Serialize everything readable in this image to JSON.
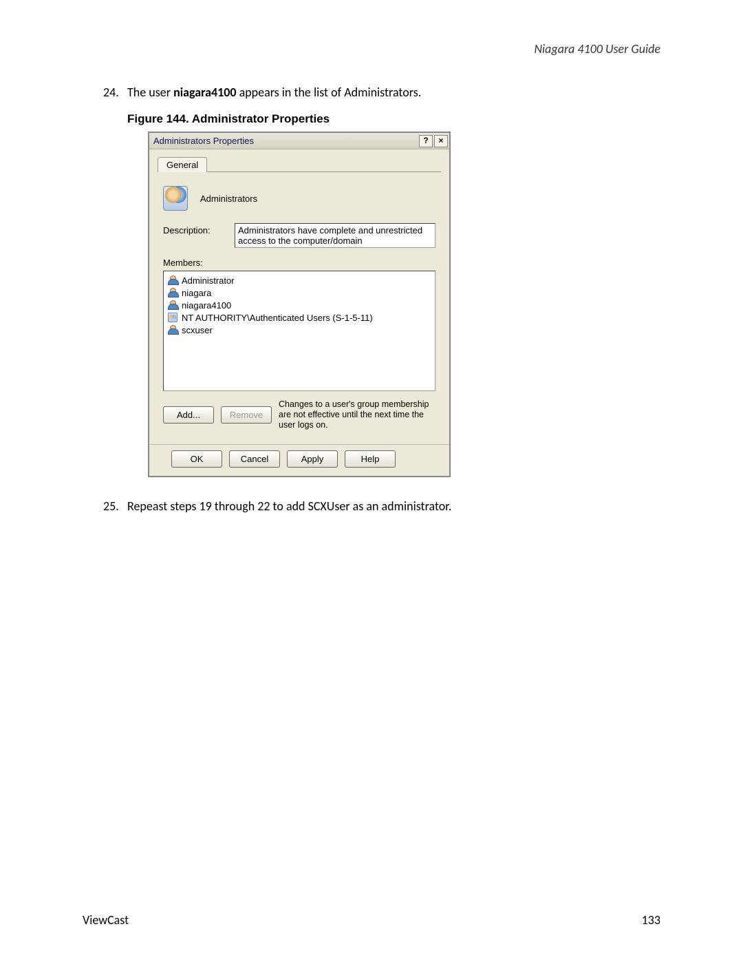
{
  "header": {
    "guide_title": "Niagara 4100 User Guide"
  },
  "steps": {
    "s24": {
      "num": "24.",
      "prefix": "The user ",
      "bold": "niagara4100",
      "suffix": " appears in the list of Administrators."
    },
    "s25": {
      "num": "25.",
      "text": "Repeast steps 19 through 22 to add SCXUser as an administrator."
    }
  },
  "figure": {
    "caption": "Figure 144. Administrator Properties"
  },
  "dialog": {
    "title": "Administrators Properties",
    "help_btn": "?",
    "close_btn": "×",
    "tab_general": "General",
    "group_name": "Administrators",
    "description_label": "Description:",
    "description_value": "Administrators have complete and unrestricted access to the computer/domain",
    "members_label": "Members:",
    "members": [
      {
        "icon": "user",
        "name": "Administrator"
      },
      {
        "icon": "user",
        "name": "niagara"
      },
      {
        "icon": "user",
        "name": "niagara4100"
      },
      {
        "icon": "group",
        "name": "NT AUTHORITY\\Authenticated Users (S-1-5-11)"
      },
      {
        "icon": "user",
        "name": "scxuser"
      }
    ],
    "add_btn": "Add...",
    "remove_btn": "Remove",
    "change_note": "Changes to a user's group membership are not effective until the next time the user logs on.",
    "ok_btn": "OK",
    "cancel_btn": "Cancel",
    "apply_btn": "Apply",
    "help_footer_btn": "Help"
  },
  "footer": {
    "left": "ViewCast",
    "right": "133"
  }
}
